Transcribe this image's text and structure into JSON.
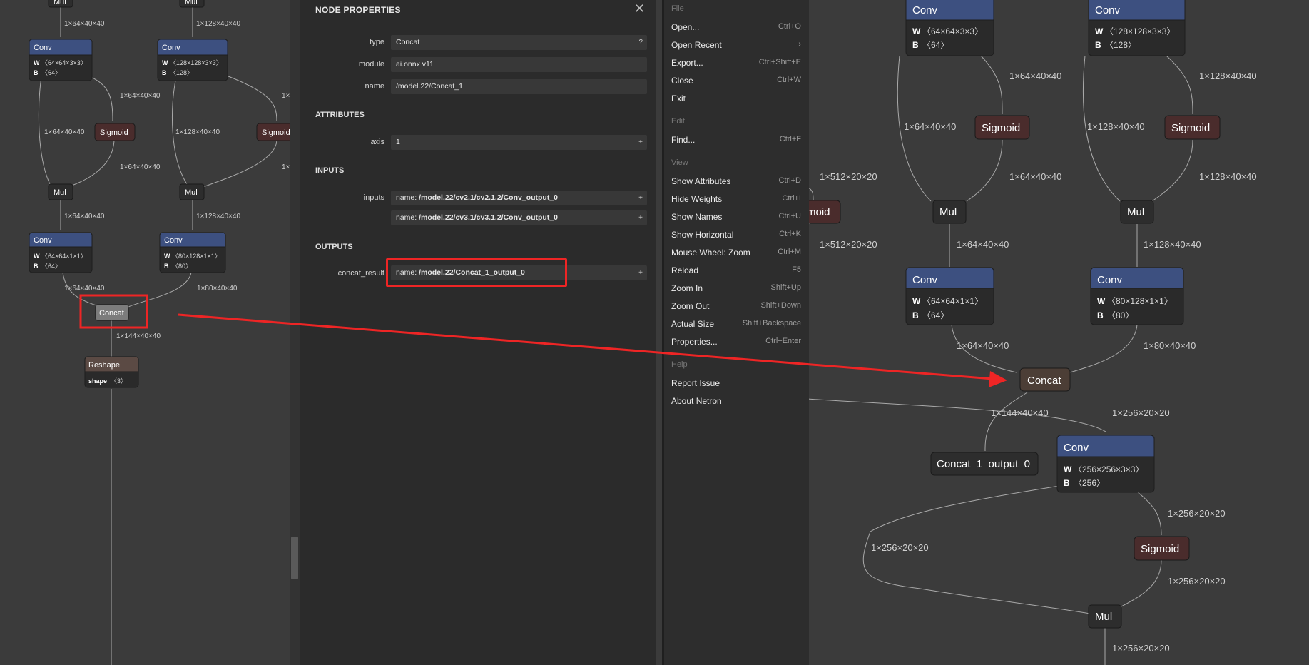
{
  "left_graph": {
    "top_nodes": [
      "Mul",
      "Mul"
    ],
    "edges": {
      "e1": "1×64×40×40",
      "e2": "1×128×40×40",
      "e3": "1×64×40×40",
      "e4": "1×64×40×40",
      "e5": "1×128×40×40",
      "e6": "1×",
      "e7": "1×64×40×40",
      "e8": "1×",
      "e9": "1×64×40×40",
      "e10": "1×128×40×40",
      "e11": "1×64×40×40",
      "e12": "1×80×40×40",
      "e13": "1×144×40×40"
    },
    "conv1": {
      "title": "Conv",
      "w": "〈64×64×3×3〉",
      "b": "〈64〉"
    },
    "conv2": {
      "title": "Conv",
      "w": "〈128×128×3×3〉",
      "b": "〈128〉"
    },
    "sig1": "Sigmoid",
    "sig2": "Sigmoid",
    "mul1": "Mul",
    "mul2": "Mul",
    "conv3": {
      "title": "Conv",
      "w": "〈64×64×1×1〉",
      "b": "〈64〉"
    },
    "conv4": {
      "title": "Conv",
      "w": "〈80×128×1×1〉",
      "b": "〈80〉"
    },
    "concat": "Concat",
    "reshape": {
      "title": "Reshape",
      "attr": "shape",
      "val": "〈3〉"
    },
    "w_label": "W",
    "b_label": "B"
  },
  "properties": {
    "title": "NODE PROPERTIES",
    "close": "✕",
    "type_label": "type",
    "type_value": "Concat",
    "type_btn": "?",
    "module_label": "module",
    "module_value": "ai.onnx v11",
    "name_label": "name",
    "name_value": "/model.22/Concat_1",
    "attributes_header": "ATTRIBUTES",
    "axis_label": "axis",
    "axis_value": "1",
    "axis_btn": "+",
    "inputs_header": "INPUTS",
    "inputs_label": "inputs",
    "input1_prefix": "name: ",
    "input1_value": "/model.22/cv2.1/cv2.1.2/Conv_output_0",
    "input2_prefix": "name: ",
    "input2_value": "/model.22/cv3.1/cv3.1.2/Conv_output_0",
    "outputs_header": "OUTPUTS",
    "output_label": "concat_result",
    "output_prefix": "name: ",
    "output_value": "/model.22/Concat_1_output_0",
    "plus": "+"
  },
  "menu": {
    "groups": [
      {
        "header": "File",
        "items": [
          {
            "label": "Open...",
            "shortcut": "Ctrl+O"
          },
          {
            "label": "Open Recent",
            "shortcut": "›"
          },
          {
            "label": "Export...",
            "shortcut": "Ctrl+Shift+E"
          },
          {
            "label": "Close",
            "shortcut": "Ctrl+W"
          },
          {
            "label": "Exit",
            "shortcut": ""
          }
        ]
      },
      {
        "header": "Edit",
        "items": [
          {
            "label": "Find...",
            "shortcut": "Ctrl+F"
          }
        ]
      },
      {
        "header": "View",
        "items": [
          {
            "label": "Show Attributes",
            "shortcut": "Ctrl+D"
          },
          {
            "label": "Hide Weights",
            "shortcut": "Ctrl+I"
          },
          {
            "label": "Show Names",
            "shortcut": "Ctrl+U"
          },
          {
            "label": "Show Horizontal",
            "shortcut": "Ctrl+K"
          },
          {
            "label": "Mouse Wheel: Zoom",
            "shortcut": "Ctrl+M"
          },
          {
            "label": "Reload",
            "shortcut": "F5"
          },
          {
            "label": "Zoom In",
            "shortcut": "Shift+Up"
          },
          {
            "label": "Zoom Out",
            "shortcut": "Shift+Down"
          },
          {
            "label": "Actual Size",
            "shortcut": "Shift+Backspace"
          },
          {
            "label": "Properties...",
            "shortcut": "Ctrl+Enter"
          }
        ]
      },
      {
        "header": "Help",
        "items": [
          {
            "label": "Report Issue",
            "shortcut": ""
          },
          {
            "label": "About Netron",
            "shortcut": ""
          }
        ]
      }
    ]
  },
  "right_graph": {
    "conv1": {
      "title": "Conv",
      "w": "〈64×64×3×3〉",
      "b": "〈64〉"
    },
    "conv2": {
      "title": "Conv",
      "w": "〈128×128×3×3〉",
      "b": "〈128〉"
    },
    "sig1": "Sigmoid",
    "sig2": "Sigmoid",
    "mul1": "Mul",
    "mul2": "Mul",
    "conv3": {
      "title": "Conv",
      "w": "〈64×64×1×1〉",
      "b": "〈64〉"
    },
    "conv4": {
      "title": "Conv",
      "w": "〈80×128×1×1〉",
      "b": "〈80〉"
    },
    "concat": "Concat",
    "output": "Concat_1_output_0",
    "conv5": {
      "title": "Conv",
      "w": "〈256×256×3×3〉",
      "b": "〈256〉"
    },
    "sig3": "Sigmoid",
    "mul3": "Mul",
    "partial_sig": "moid",
    "w_label": "W",
    "b_label": "B",
    "edges": {
      "a": "1×64×40×40",
      "b": "1×128×40×40",
      "c": "1×64×40×40",
      "d": "1×128×40×40",
      "e": "1×64×40×40",
      "f": "1×128×40×40",
      "g": "1×64×40×40",
      "h": "1×128×40×40",
      "i": "1×64×40×40",
      "j": "1×80×40×40",
      "k": "1×144×40×40",
      "l": "1×256×20×20",
      "m": "1×256×20×20",
      "n": "1×256×20×20",
      "o": "1×256×20×20",
      "p": "1×256×20×20",
      "q": "1×512×20×20",
      "r": "1×512×20×20"
    }
  },
  "colors": {
    "highlight": "#ee2525",
    "conv_header": "#3d5080",
    "sigmoid": "#4a2c2c",
    "concat": "#4c3e36"
  }
}
